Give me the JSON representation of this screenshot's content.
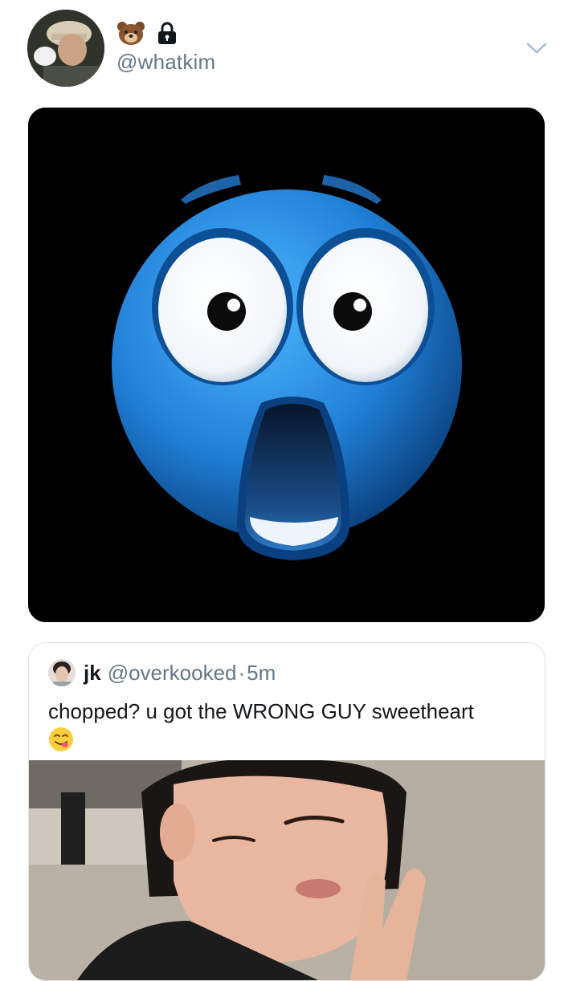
{
  "tweet": {
    "handle": "@whatkim",
    "badges": [
      "bear-emoji",
      "lock-icon"
    ],
    "menu_icon": "chevron-down-icon",
    "media_description_icon": "shocked-blue-emoji"
  },
  "quoted_tweet": {
    "name": "jk",
    "handle": "@overkooked",
    "separator": "·",
    "time": "5m",
    "text": "chopped? u got the WRONG GUY sweetheart",
    "trailing_emoji": "yum-face-emoji"
  },
  "colors": {
    "handle_gray": "#657786",
    "text_dark": "#14171a",
    "border": "#dfe4ea",
    "emoji_blue": "#1f7fd6"
  }
}
